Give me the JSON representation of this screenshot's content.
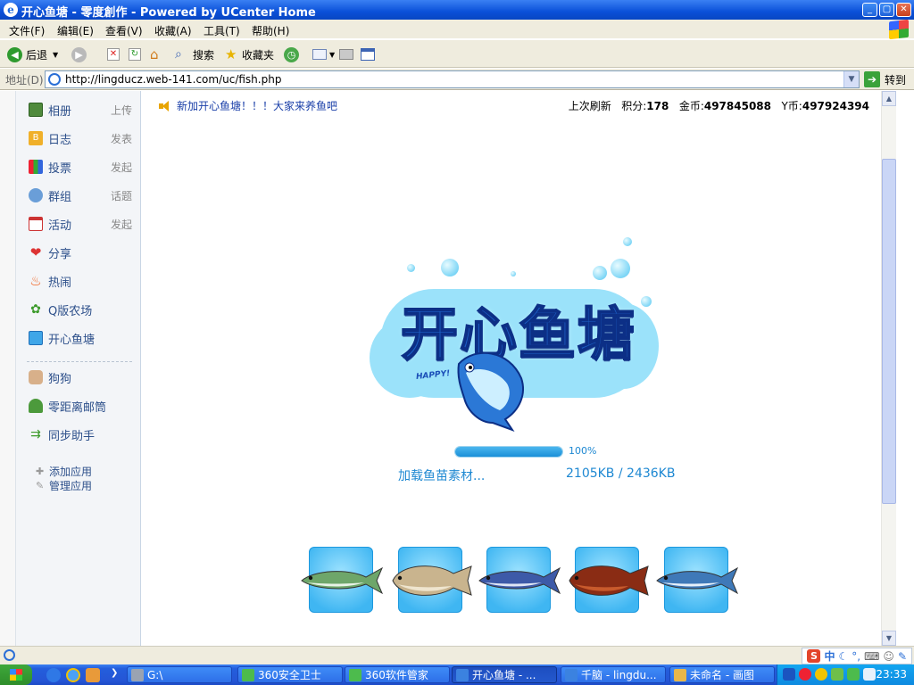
{
  "window": {
    "title": "开心鱼塘 - 零度創作 - Powered by UCenter Home",
    "min": "_",
    "max": "▢",
    "close": "✕"
  },
  "menu": [
    "文件(F)",
    "编辑(E)",
    "查看(V)",
    "收藏(A)",
    "工具(T)",
    "帮助(H)"
  ],
  "toolbar": {
    "back": "后退",
    "search": "搜索",
    "favorites": "收藏夹"
  },
  "address": {
    "label": "地址(D)",
    "url": "http://lingducz.web-141.com/uc/fish.php",
    "go": "转到"
  },
  "sidebar": {
    "items": [
      {
        "label": "相册",
        "action": "上传"
      },
      {
        "label": "日志",
        "action": "发表"
      },
      {
        "label": "投票",
        "action": "发起"
      },
      {
        "label": "群组",
        "action": "话题"
      },
      {
        "label": "活动",
        "action": "发起"
      },
      {
        "label": "分享",
        "action": ""
      },
      {
        "label": "热闹",
        "action": ""
      },
      {
        "label": "Q版农场",
        "action": ""
      },
      {
        "label": "开心鱼塘",
        "action": ""
      }
    ],
    "apps": [
      {
        "label": "狗狗"
      },
      {
        "label": "零距离邮筒"
      },
      {
        "label": "同步助手"
      }
    ],
    "add_app": "添加应用",
    "manage_app": "管理应用"
  },
  "notice": "新加开心鱼塘！！！大家来养鱼吧",
  "stats": {
    "refresh": "上次刷新",
    "score_label": "积分:",
    "score": "178",
    "gold_label": "金币:",
    "gold": "497845088",
    "y_label": "Y币:",
    "y": "497924394"
  },
  "game": {
    "logo_text": "开心鱼塘",
    "logo_tag": "HAPPY!",
    "progress": 100,
    "progress_label": "100%",
    "loading_text": "加载鱼苗素材...",
    "loaded_size": "2105KB / 2436KB"
  },
  "fish": [
    {
      "name": "mackerel",
      "body": "#6ea66a",
      "belly": "#e8f3e6"
    },
    {
      "name": "flounder",
      "body": "#c9b48e",
      "belly": "#efe5cf"
    },
    {
      "name": "saury",
      "body": "#3d5aa8",
      "belly": "#dfe6f5"
    },
    {
      "name": "scorpionfish",
      "body": "#8a2c14",
      "belly": "#c85a2c"
    },
    {
      "name": "sardine",
      "body": "#3f79b8",
      "belly": "#e6f0fa"
    }
  ],
  "taskbar": {
    "tasks": [
      {
        "label": "G:\\",
        "active": false
      },
      {
        "label": "360安全卫士",
        "active": false
      },
      {
        "label": "360软件管家",
        "active": false
      },
      {
        "label": "开心鱼塘 - ...",
        "active": true
      },
      {
        "label": "千脑 - lingdu...",
        "active": false
      },
      {
        "label": "未命名 - 画图",
        "active": false
      }
    ],
    "clock": "23:33"
  },
  "ime": {
    "s": "S",
    "lang": "中"
  },
  "colors": {
    "accent": "#1e88d2",
    "link": "#2c4f8a",
    "notice": "#1a3fa8"
  }
}
